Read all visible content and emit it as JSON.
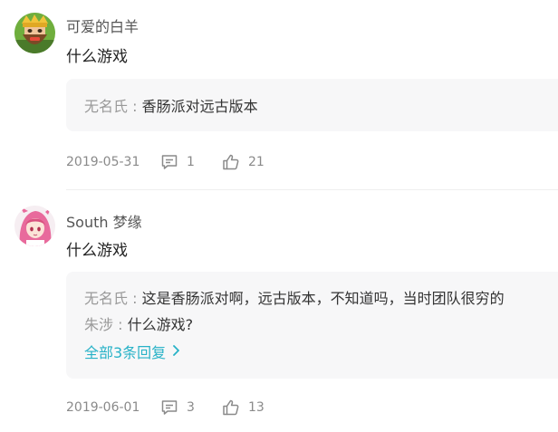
{
  "comments": [
    {
      "username": "可爱的白羊",
      "text": "什么游戏",
      "replies": [
        {
          "name": "无名氏",
          "sep": " : ",
          "text": "香肠派对远古版本"
        }
      ],
      "date": "2019-05-31",
      "reply_count": "1",
      "like_count": "21",
      "avatar_icon": "clash-royale-king-avatar-icon"
    },
    {
      "username": "South 梦缘",
      "text": "什么游戏",
      "replies": [
        {
          "name": "无名氏",
          "sep": " : ",
          "text": "这是香肠派对啊，远古版本，不知道吗，当时团队很穷的"
        },
        {
          "name": "朱涉",
          "sep": " : ",
          "text": "什么游戏?"
        }
      ],
      "more_label": "全部3条回复",
      "date": "2019-06-01",
      "reply_count": "3",
      "like_count": "13",
      "avatar_icon": "anime-pink-hair-girl-avatar-icon"
    }
  ],
  "colors": {
    "link": "#27b2c7",
    "meta": "#8a8a8a",
    "reply_bg": "#f7f7f8"
  },
  "icons": {
    "reply": "comment-bubble-icon",
    "like": "thumbs-up-icon",
    "more": "chevron-right-icon"
  }
}
